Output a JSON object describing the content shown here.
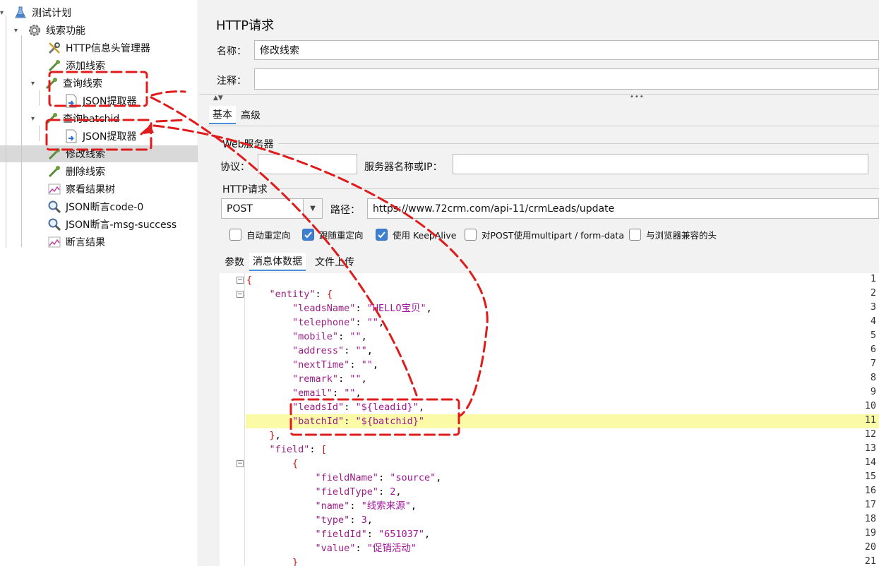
{
  "tree": {
    "items": [
      {
        "label": "测试计划",
        "icon": "flask-icon"
      },
      {
        "label": "线索功能",
        "icon": "gear-icon"
      },
      {
        "label": "HTTP信息头管理器",
        "icon": "wrench-icon"
      },
      {
        "label": "添加线索",
        "icon": "pipette-icon"
      },
      {
        "label": "查询线索",
        "icon": "pipette-icon"
      },
      {
        "label": "JSON提取器",
        "icon": "extractor-icon"
      },
      {
        "label": "查询batchid",
        "icon": "pipette-icon"
      },
      {
        "label": "JSON提取器",
        "icon": "extractor-icon"
      },
      {
        "label": "修改线索",
        "icon": "pipette-icon"
      },
      {
        "label": "删除线索",
        "icon": "pipette-icon"
      },
      {
        "label": "察看结果树",
        "icon": "graph-icon"
      },
      {
        "label": "JSON断言code-0",
        "icon": "magnifier-icon"
      },
      {
        "label": "JSON断言-msg-success",
        "icon": "magnifier-icon"
      },
      {
        "label": "断言结果",
        "icon": "graph-icon"
      }
    ]
  },
  "panel": {
    "title": "HTTP请求",
    "name_label": "名称：",
    "name_value": "修改线索",
    "comment_label": "注释：",
    "comment_value": ""
  },
  "tabs": {
    "basic": "基本",
    "advanced": "高级"
  },
  "web_server": {
    "section_title": "Web服务器",
    "protocol_label": "协议：",
    "protocol_value": "",
    "server_label": "服务器名称或IP：",
    "server_value": ""
  },
  "http_request": {
    "section_title": "HTTP请求",
    "method": "POST",
    "path_label": "路径：",
    "path_value": "https://www.72crm.com/api-11/crmLeads/update"
  },
  "options": [
    {
      "label": "自动重定向",
      "checked": false
    },
    {
      "label": "跟随重定向",
      "checked": true
    },
    {
      "label": "使用 KeepAlive",
      "checked": true
    },
    {
      "label": "对POST使用multipart / form-data",
      "checked": false
    },
    {
      "label": "与浏览器兼容的头",
      "checked": false
    }
  ],
  "body_tabs": {
    "params": "参数",
    "body": "消息体数据",
    "files": "文件上传"
  },
  "code": {
    "line_numbers": [
      "1",
      "2",
      "3",
      "4",
      "5",
      "6",
      "7",
      "8",
      "9",
      "10",
      "11",
      "12",
      "13",
      "14",
      "15",
      "16",
      "17",
      "18",
      "19",
      "20",
      "21"
    ],
    "line_count": 21,
    "highlighted_line": 11
  },
  "colors": {
    "annotation": "#e01b1b",
    "selection": "#d9d9d9",
    "line_highlight": "#fbfba7",
    "json_key": "#9b1e86"
  }
}
